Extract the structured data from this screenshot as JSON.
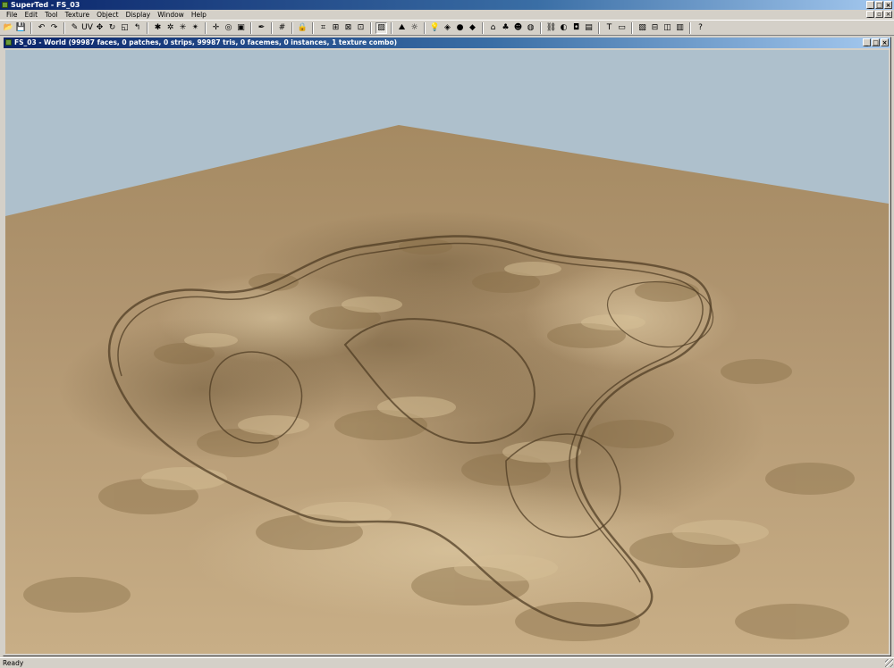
{
  "app": {
    "title": "SuperTed - FS_03",
    "window_controls": [
      "_",
      "□",
      "×"
    ]
  },
  "menu": [
    "File",
    "Edit",
    "Tool",
    "Texture",
    "Object",
    "Display",
    "Window",
    "Help"
  ],
  "mdi_controls": [
    "_",
    "▫",
    "×"
  ],
  "toolbar": {
    "icons": [
      {
        "name": "open-icon",
        "glyph": "📂"
      },
      {
        "name": "save-icon",
        "glyph": "💾"
      },
      {
        "name": "sep"
      },
      {
        "name": "undo-icon",
        "glyph": "↶"
      },
      {
        "name": "redo-icon",
        "glyph": "↷"
      },
      {
        "name": "sep"
      },
      {
        "name": "brush-icon",
        "glyph": "✎"
      },
      {
        "name": "uv-icon",
        "glyph": "UV"
      },
      {
        "name": "move-icon",
        "glyph": "✥"
      },
      {
        "name": "rotate-icon",
        "glyph": "↻"
      },
      {
        "name": "scale-icon",
        "glyph": "◱"
      },
      {
        "name": "hook-icon",
        "glyph": "↰"
      },
      {
        "name": "sep"
      },
      {
        "name": "tool-a-icon",
        "glyph": "✱"
      },
      {
        "name": "tool-b-icon",
        "glyph": "✲"
      },
      {
        "name": "tool-c-icon",
        "glyph": "✳"
      },
      {
        "name": "tool-d-icon",
        "glyph": "✴"
      },
      {
        "name": "sep"
      },
      {
        "name": "pan-icon",
        "glyph": "✛"
      },
      {
        "name": "orbit-icon",
        "glyph": "◎"
      },
      {
        "name": "frame-icon",
        "glyph": "▣"
      },
      {
        "name": "sep"
      },
      {
        "name": "eyedropper-icon",
        "glyph": "✒"
      },
      {
        "name": "sep"
      },
      {
        "name": "grid-icon",
        "glyph": "#"
      },
      {
        "name": "sep"
      },
      {
        "name": "lock-icon",
        "glyph": "🔒"
      },
      {
        "name": "sep"
      },
      {
        "name": "snap-a-icon",
        "glyph": "⌗"
      },
      {
        "name": "snap-b-icon",
        "glyph": "⊞"
      },
      {
        "name": "snap-c-icon",
        "glyph": "⊠"
      },
      {
        "name": "snap-d-icon",
        "glyph": "⊡"
      },
      {
        "name": "sep"
      },
      {
        "name": "texture-icon",
        "glyph": "▨",
        "active": true
      },
      {
        "name": "sep"
      },
      {
        "name": "terrain-icon",
        "glyph": "⛰"
      },
      {
        "name": "light-icon",
        "glyph": "☼"
      },
      {
        "name": "sep"
      },
      {
        "name": "bulb-icon",
        "glyph": "💡"
      },
      {
        "name": "cube-icon",
        "glyph": "◈"
      },
      {
        "name": "sphere-icon",
        "glyph": "●"
      },
      {
        "name": "object-icon",
        "glyph": "◆"
      },
      {
        "name": "sep"
      },
      {
        "name": "house-icon",
        "glyph": "⌂"
      },
      {
        "name": "tree-icon",
        "glyph": "♣"
      },
      {
        "name": "people-icon",
        "glyph": "☻"
      },
      {
        "name": "globe-icon",
        "glyph": "◍"
      },
      {
        "name": "sep"
      },
      {
        "name": "link-icon",
        "glyph": "⛓"
      },
      {
        "name": "paint-icon",
        "glyph": "◐"
      },
      {
        "name": "camera-icon",
        "glyph": "◘"
      },
      {
        "name": "render-icon",
        "glyph": "▤"
      },
      {
        "name": "sep"
      },
      {
        "name": "text-icon",
        "glyph": "T"
      },
      {
        "name": "panel-icon",
        "glyph": "▭"
      },
      {
        "name": "sep"
      },
      {
        "name": "image-icon",
        "glyph": "▧"
      },
      {
        "name": "wire-icon",
        "glyph": "⊟"
      },
      {
        "name": "split-icon",
        "glyph": "◫"
      },
      {
        "name": "view-icon",
        "glyph": "▥"
      },
      {
        "name": "sep"
      },
      {
        "name": "help-icon",
        "glyph": "?"
      }
    ]
  },
  "document": {
    "title": "FS_03 - World (99987 faces, 0 patches, 0 strips, 99987 tris, 0 facemes, 0 instances, 1 texture combo)",
    "window_controls": [
      "_",
      "□",
      "×"
    ]
  },
  "colors": {
    "sky": "#aec0cc",
    "sand_light": "#c3a97f",
    "sand_mid": "#a58a60",
    "sand_dark": "#6e5838",
    "track": "#4a3820"
  },
  "status": {
    "text": "Ready"
  }
}
